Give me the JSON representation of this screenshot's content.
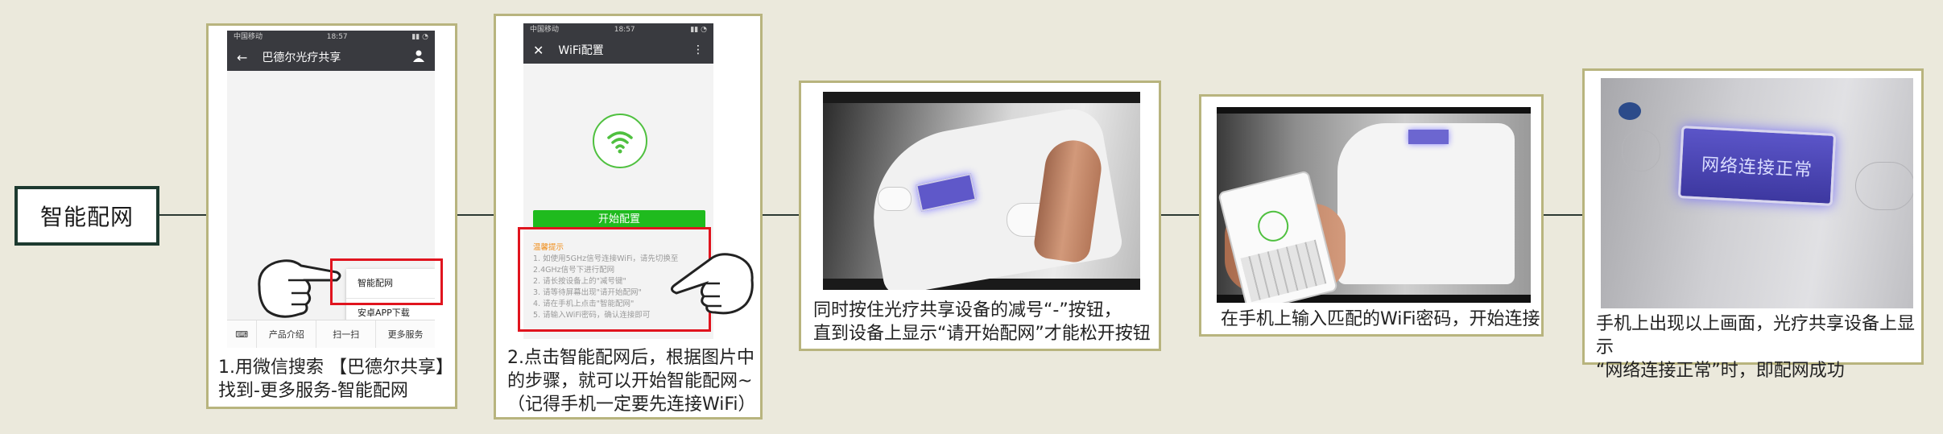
{
  "start_label": "智能配网",
  "step1": {
    "status_left": "中国移动",
    "status_time": "18:57",
    "appbar_title": "巴德尔光疗共享",
    "menu_items": [
      "智能配网",
      "安卓APP下载"
    ],
    "bottom_tabs": [
      "产品介绍",
      "扫一扫",
      "更多服务"
    ],
    "caption": "1.用微信搜索 【巴德尔共享】\n找到-更多服务-智能配网"
  },
  "step2": {
    "status_left": "中国移动",
    "status_time": "18:57",
    "appbar_title": "WiFi配置",
    "start_button": "开始配置",
    "tips_title": "温馨提示",
    "tips": [
      "1. 如使用5GHz信号连接WiFi，请先切换至",
      "2.4GHz信号下进行配网",
      "2. 请长按设备上的\"减号键\"",
      "3. 请等待屏幕出现\"请开始配网\"",
      "4. 请在手机上点击\"智能配网\"",
      "5. 请输入WiFi密码，确认连接即可"
    ],
    "caption": "2.点击智能配网后，根据图片中\n的步骤，就可以开始智能配网~\n（记得手机一定要先连接WiFi）"
  },
  "step3": {
    "caption": "同时按住光疗共享设备的减号“-”按钮，\n直到设备上显示“请开始配网”才能松开按钮"
  },
  "step4": {
    "caption": "在手机上输入匹配的WiFi密码，开始连接"
  },
  "step5": {
    "screen_text": "网络连接正常",
    "caption": "手机上出现以上画面，光疗共享设备上显示\n“网络连接正常”时，即配网成功"
  },
  "colors": {
    "accent_green": "#1fbb1e",
    "highlight_red": "#e0141e",
    "card_border": "#b8b47e",
    "start_border": "#1d3a30"
  }
}
